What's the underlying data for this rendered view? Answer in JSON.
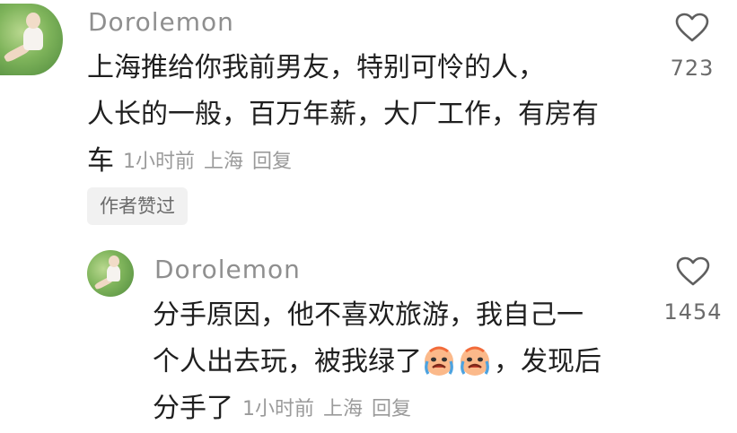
{
  "comment": {
    "username": "Dorolemon",
    "lines": [
      "上海推给你我前男友，特别可怜的人，",
      "人长的一般，百万年薪，大厂工作，有房有",
      "车"
    ],
    "time": "1小时前",
    "location": "上海",
    "reply_label": "回复",
    "likes": "723",
    "author_liked_badge": "作者赞过"
  },
  "reply": {
    "username": "Dorolemon",
    "line1": "分手原因，他不喜欢旅游，我自己一",
    "line2_before_emoji": "个人出去玩，被我绿了",
    "line2_after_emoji": "，发现后",
    "line3": "分手了",
    "emojis": [
      "crying-face-emoji",
      "crying-face-emoji"
    ],
    "time": "1小时前",
    "location": "上海",
    "reply_label": "回复",
    "likes": "1454"
  }
}
